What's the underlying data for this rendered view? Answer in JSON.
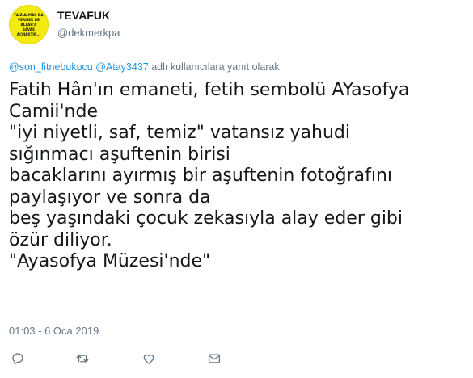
{
  "author": {
    "avatar_text": [
      "FAİZ ALMAK DA",
      "VERMEK DE",
      "ALLAH'A",
      "SAVAŞ",
      "AÇMAKTIR..."
    ],
    "display_name": "TEVAFUK",
    "handle": "@dekmerkpa"
  },
  "reply": {
    "mention_1": "@son_fitnebukucu",
    "mention_2": "@Atay3437",
    "suffix": "adlı kullanıcılara yanıt olarak"
  },
  "tweet": {
    "lines": [
      "Fatih Hân'ın emaneti, fetih sembolü AYasofya",
      "Camii'nde",
      "\"iyi niyetli, saf, temiz\" vatansız yahudi",
      "sığınmacı aşuftenin birisi",
      "bacaklarını ayırmış bir aşuftenin fotoğrafını",
      "paylaşıyor ve sonra da",
      "beş yaşındaki çocuk zekasıyla alay eder gibi",
      "özür diliyor.",
      "\"Ayasofya Müzesi'nde\""
    ],
    "timestamp": "01:03 - 6 Oca 2019"
  },
  "actions": {
    "icons": [
      "reply-icon",
      "retweet-icon",
      "like-icon",
      "message-icon"
    ],
    "icon_color": "#657786"
  },
  "colors": {
    "link": "#1b95e0",
    "secondary_text": "#657786",
    "avatar_bg": "#f3ea10"
  }
}
